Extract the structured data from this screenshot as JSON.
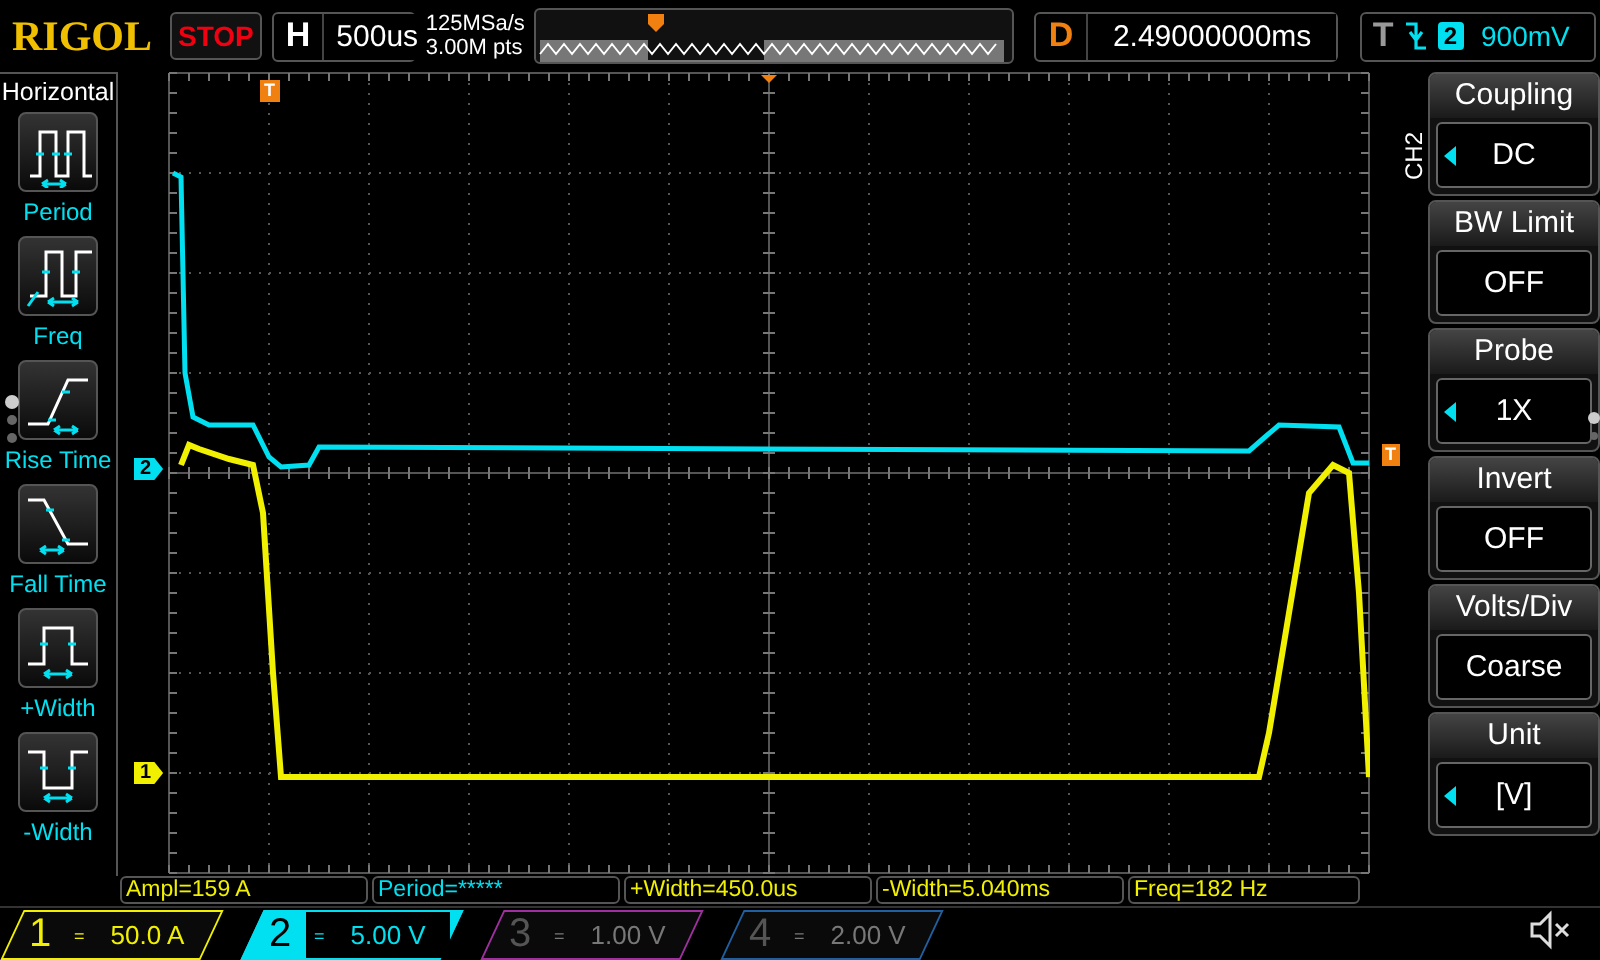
{
  "brand": "RIGOL",
  "run_state": "STOP",
  "timebase": {
    "label": "H",
    "value": "500us"
  },
  "acquisition": {
    "sample_rate": "125MSa/s",
    "memory_depth": "3.00M pts"
  },
  "delay": {
    "label": "D",
    "value": "2.49000000ms"
  },
  "trigger": {
    "label": "T",
    "falling_edge": true,
    "channel": "2",
    "level": "900mV"
  },
  "left_menu": {
    "title": "Horizontal",
    "items": [
      {
        "kind": "period",
        "label": "Period"
      },
      {
        "kind": "freq",
        "label": "Freq"
      },
      {
        "kind": "rise",
        "label": "Rise Time"
      },
      {
        "kind": "fall",
        "label": "Fall Time"
      },
      {
        "kind": "pwidth",
        "label": "+Width"
      },
      {
        "kind": "nwidth",
        "label": "-Width"
      }
    ]
  },
  "waveform": {
    "channel_markers": [
      {
        "label": "2",
        "color": "#00e0f0"
      },
      {
        "label": "1",
        "color": "#f0f000"
      }
    ],
    "trigger_marker": "T",
    "position_marker": "T"
  },
  "right_menu": {
    "channel": "CH2",
    "items": [
      {
        "label": "Coupling",
        "value": "DC",
        "has_options": true
      },
      {
        "label": "BW Limit",
        "value": "OFF",
        "has_options": false
      },
      {
        "label": "Probe",
        "value": "1X",
        "has_options": true
      },
      {
        "label": "Invert",
        "value": "OFF",
        "has_options": false
      },
      {
        "label": "Volts/Div",
        "value": "Coarse",
        "has_options": false
      },
      {
        "label": "Unit",
        "value": "[V]",
        "has_options": true
      }
    ]
  },
  "measurements": [
    {
      "text": "Ampl=159 A",
      "color": "#f0f000"
    },
    {
      "text": "Period=*****",
      "color": "#00e0f0"
    },
    {
      "text": "+Width=450.0us",
      "color": "#f0f000"
    },
    {
      "text": "-Width=5.040ms",
      "color": "#f0f000"
    },
    {
      "text": "Freq=182 Hz",
      "color": "#f0f000"
    }
  ],
  "channels": [
    {
      "number": "1",
      "coupling": "=",
      "scale": "50.0 A",
      "enabled": true,
      "selected": false,
      "color": "#f0f000"
    },
    {
      "number": "2",
      "coupling": "=",
      "scale": "5.00 V",
      "enabled": true,
      "selected": true,
      "color": "#00e0f0"
    },
    {
      "number": "3",
      "coupling": "=",
      "scale": "1.00 V",
      "enabled": false,
      "selected": false,
      "color": "#a030a0"
    },
    {
      "number": "4",
      "coupling": "=",
      "scale": "2.00 V",
      "enabled": false,
      "selected": false,
      "color": "#2060a0"
    }
  ],
  "sound": {
    "muted": true
  }
}
